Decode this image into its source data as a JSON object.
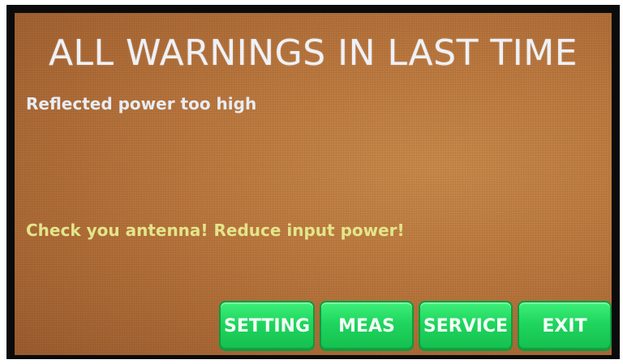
{
  "screen": {
    "title": "ALL WARNINGS IN LAST TIME",
    "warning_message": "Reflected power too high",
    "advice_message": "Check you antenna!   Reduce input power!"
  },
  "buttons": {
    "setting_label": "SETTING",
    "meas_label": "MEAS",
    "service_label": "SERVICE",
    "exit_label": "EXIT"
  },
  "colors": {
    "background": "#b9763d",
    "title_text": "#eef1f6",
    "advice_text": "#e3e58a",
    "button_green": "#1fd55e"
  }
}
